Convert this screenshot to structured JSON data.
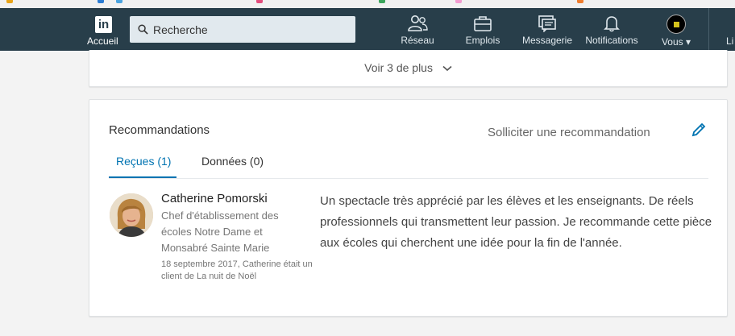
{
  "navbar": {
    "home_label": "Accueil",
    "logo_text": "in",
    "search_placeholder": "Recherche",
    "items": [
      {
        "label": "Réseau",
        "icon": "network-icon"
      },
      {
        "label": "Emplois",
        "icon": "briefcase-icon"
      },
      {
        "label": "Messagerie",
        "icon": "messaging-icon"
      },
      {
        "label": "Notifications",
        "icon": "bell-icon"
      },
      {
        "label": "Vous ▾",
        "icon": "avatar"
      }
    ],
    "extra_label": "Li"
  },
  "experience_card": {
    "see_more": "Voir 3 de plus"
  },
  "recommendations": {
    "title": "Recommandations",
    "ask_label": "Solliciter une recommandation",
    "tabs": [
      {
        "label": "Reçues (1)",
        "active": true
      },
      {
        "label": "Données (0)",
        "active": false
      }
    ],
    "items": [
      {
        "name": "Catherine Pomorski",
        "headline": "Chef d'établissement des écoles Notre Dame et Monsabré Sainte Marie",
        "meta": "18 septembre 2017, Catherine était un client de La nuit de Noël",
        "text": "Un spectacle très apprécié par les élèves et les enseignants. De réels professionnels qui transmettent leur passion. Je recommande cette pièce aux écoles qui cherchent une idée pour la fin de l'année."
      }
    ]
  },
  "colors": {
    "navbar_bg": "#283e4a",
    "accent": "#0073b1",
    "page_bg": "#f3f3f3"
  }
}
